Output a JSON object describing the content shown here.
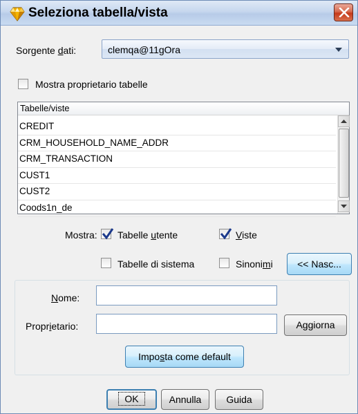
{
  "window": {
    "title": "Seleziona tabella/vista"
  },
  "source": {
    "label_pre": "Sorgente ",
    "label_ul": "d",
    "label_post": "ati:",
    "value": "clemqa@11gOra"
  },
  "show_owner": {
    "label": "Mostra proprietario tabelle",
    "checked": false
  },
  "table_list": {
    "header": "Tabelle/viste",
    "rows": [
      "CREDIT",
      "CRM_HOUSEHOLD_NAME_ADDR",
      "CRM_TRANSACTION",
      "CUST1",
      "CUST2",
      "Coods1n_de"
    ]
  },
  "show": {
    "label": "Mostra:",
    "user_tables": {
      "pre": "Tabelle ",
      "ul": "u",
      "post": "tente",
      "checked": true
    },
    "views": {
      "pre": "",
      "ul": "V",
      "post": "iste",
      "checked": true
    },
    "system_tables": {
      "label": "Tabelle di sistema",
      "checked": false
    },
    "synonyms": {
      "pre": "Sinoni",
      "ul": "m",
      "post": "i",
      "checked": false
    },
    "hide_button": "<< Nasc..."
  },
  "filter": {
    "name_pre": "",
    "name_ul": "N",
    "name_post": "ome:",
    "owner_pre": "Propr",
    "owner_ul": "i",
    "owner_post": "etario:",
    "name_value": "",
    "owner_value": "",
    "refresh_button": "Aggiorna",
    "default_pre": "Impo",
    "default_ul": "s",
    "default_post": "ta come default"
  },
  "buttons": {
    "ok": "OK",
    "cancel": "Annulla",
    "help": "Guida"
  }
}
